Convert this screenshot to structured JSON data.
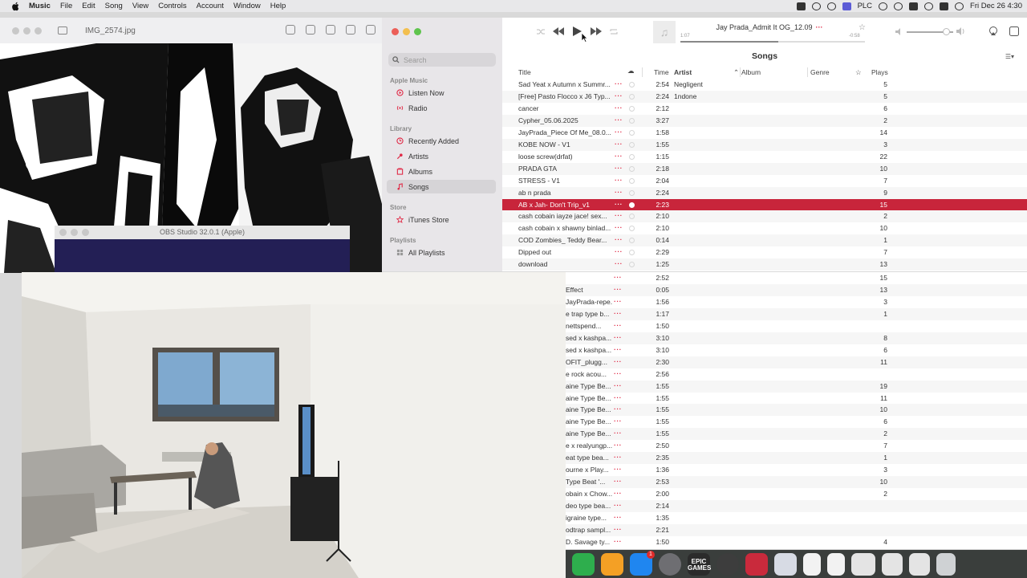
{
  "menubar": {
    "app_name": "Music",
    "menus": [
      "File",
      "Edit",
      "Song",
      "View",
      "Controls",
      "Account",
      "Window",
      "Help"
    ],
    "status_text": "PLC",
    "clock": "Fri Dec 26  4:30"
  },
  "viewer": {
    "title": "IMG_2574.jpg"
  },
  "obs": {
    "title": "OBS Studio 32.0.1 (Apple)"
  },
  "music": {
    "search_placeholder": "Search",
    "sidebar": {
      "sections": {
        "apple_music": "Apple Music",
        "library": "Library",
        "store": "Store",
        "playlists": "Playlists"
      },
      "items": {
        "listen_now": "Listen Now",
        "radio": "Radio",
        "recently_added": "Recently Added",
        "artists": "Artists",
        "albums": "Albums",
        "songs": "Songs",
        "itunes_store": "iTunes Store",
        "all_playlists": "All Playlists"
      },
      "accent": "#e02744"
    },
    "now_playing": {
      "title": "Jay Prada_Admit It OG_12.09",
      "elapsed": "1:07",
      "remaining": "-0:58",
      "progress": 0.53
    },
    "volume": 0.85,
    "view_title": "Songs",
    "columns": {
      "title": "Title",
      "time": "Time",
      "artist": "Artist",
      "album": "Album",
      "genre": "Genre",
      "plays": "Plays"
    },
    "songs": [
      {
        "title": "Sad Yeat x Autumn x Summr...",
        "time": "2:54",
        "artist": "Negligent",
        "plays": "5"
      },
      {
        "title": "[Free] Pasto Flocco x J6 Typ...",
        "time": "2:24",
        "artist": "1ndone",
        "plays": "5"
      },
      {
        "title": "cancer",
        "time": "2:12",
        "artist": "",
        "plays": "6"
      },
      {
        "title": "Cypher_05.06.2025",
        "time": "3:27",
        "artist": "",
        "plays": "2"
      },
      {
        "title": "JayPrada_Piece Of Me_08.0...",
        "time": "1:58",
        "artist": "",
        "plays": "14"
      },
      {
        "title": "KOBE NOW - V1",
        "time": "1:55",
        "artist": "",
        "plays": "3"
      },
      {
        "title": "loose screw(drfat)",
        "time": "1:15",
        "artist": "",
        "plays": "22"
      },
      {
        "title": "PRADA GTA",
        "time": "2:18",
        "artist": "",
        "plays": "10"
      },
      {
        "title": "STRESS - V1",
        "time": "2:04",
        "artist": "",
        "plays": "7"
      },
      {
        "title": "ab n prada",
        "time": "2:24",
        "artist": "",
        "plays": "9"
      },
      {
        "title": "AB x Jah- Don't Trip_v1",
        "time": "2:23",
        "artist": "",
        "plays": "15",
        "selected": true
      },
      {
        "title": "cash cobain  iayze  jace! sex...",
        "time": "2:10",
        "artist": "",
        "plays": "2"
      },
      {
        "title": "cash cobain x shawny binlad...",
        "time": "2:10",
        "artist": "",
        "plays": "10"
      },
      {
        "title": "COD Zombies_ Teddy Bear...",
        "time": "0:14",
        "artist": "",
        "plays": "1"
      },
      {
        "title": "Dipped out",
        "time": "2:29",
        "artist": "",
        "plays": "7"
      },
      {
        "title": "download",
        "time": "1:25",
        "artist": "",
        "plays": "13"
      }
    ],
    "lower_songs": [
      {
        "title": "",
        "time": "2:52",
        "plays": "15"
      },
      {
        "title": "Effect",
        "time": "0:05",
        "plays": "13"
      },
      {
        "title": "JayPrada-repe...",
        "time": "1:56",
        "plays": "3"
      },
      {
        "title": "e trap type b...",
        "time": "1:17",
        "plays": "1"
      },
      {
        "title": "nettspend...",
        "time": "1:50",
        "plays": ""
      },
      {
        "title": "sed x kashpa...",
        "time": "3:10",
        "plays": "8"
      },
      {
        "title": "sed x kashpa...",
        "time": "3:10",
        "plays": "6"
      },
      {
        "title": "OFIT_plugg...",
        "time": "2:30",
        "plays": "11"
      },
      {
        "title": "e rock  acou...",
        "time": "2:56",
        "plays": ""
      },
      {
        "title": "aine Type Be...",
        "time": "1:55",
        "plays": "19"
      },
      {
        "title": "aine Type Be...",
        "time": "1:55",
        "plays": "11"
      },
      {
        "title": "aine Type Be...",
        "time": "1:55",
        "plays": "10"
      },
      {
        "title": "aine Type Be...",
        "time": "1:55",
        "plays": "6"
      },
      {
        "title": "aine Type Be...",
        "time": "1:55",
        "plays": "2"
      },
      {
        "title": "e x realyungp...",
        "time": "2:50",
        "plays": "7"
      },
      {
        "title": "eat type bea...",
        "time": "2:35",
        "plays": "1"
      },
      {
        "title": "ourne x Play...",
        "time": "1:36",
        "plays": "3"
      },
      {
        "title": "Type Beat '...",
        "time": "2:53",
        "plays": "10"
      },
      {
        "title": "obain x Chow...",
        "time": "2:00",
        "plays": "2"
      },
      {
        "title": "deo type bea...",
        "time": "2:14",
        "plays": ""
      },
      {
        "title": "igraine type...",
        "time": "1:35",
        "plays": ""
      },
      {
        "title": "odtrap  sampl...",
        "time": "2:21",
        "plays": ""
      },
      {
        "title": "D. Savage ty...",
        "time": "1:50",
        "plays": "4"
      }
    ]
  },
  "dock": {
    "epic_label": "EPIC\nGAMES",
    "app_store_badge": "1",
    "icons": [
      "numbers-icon",
      "pages-icon",
      "app-store-icon",
      "system-settings-icon",
      "epic-games-icon",
      "obs-icon",
      "recorder-icon",
      "preview-icon",
      "music-file-icon",
      "mp3-file-icon",
      "document-icon",
      "screenshot-icon",
      "screenshot-icon",
      "trash-icon"
    ]
  }
}
